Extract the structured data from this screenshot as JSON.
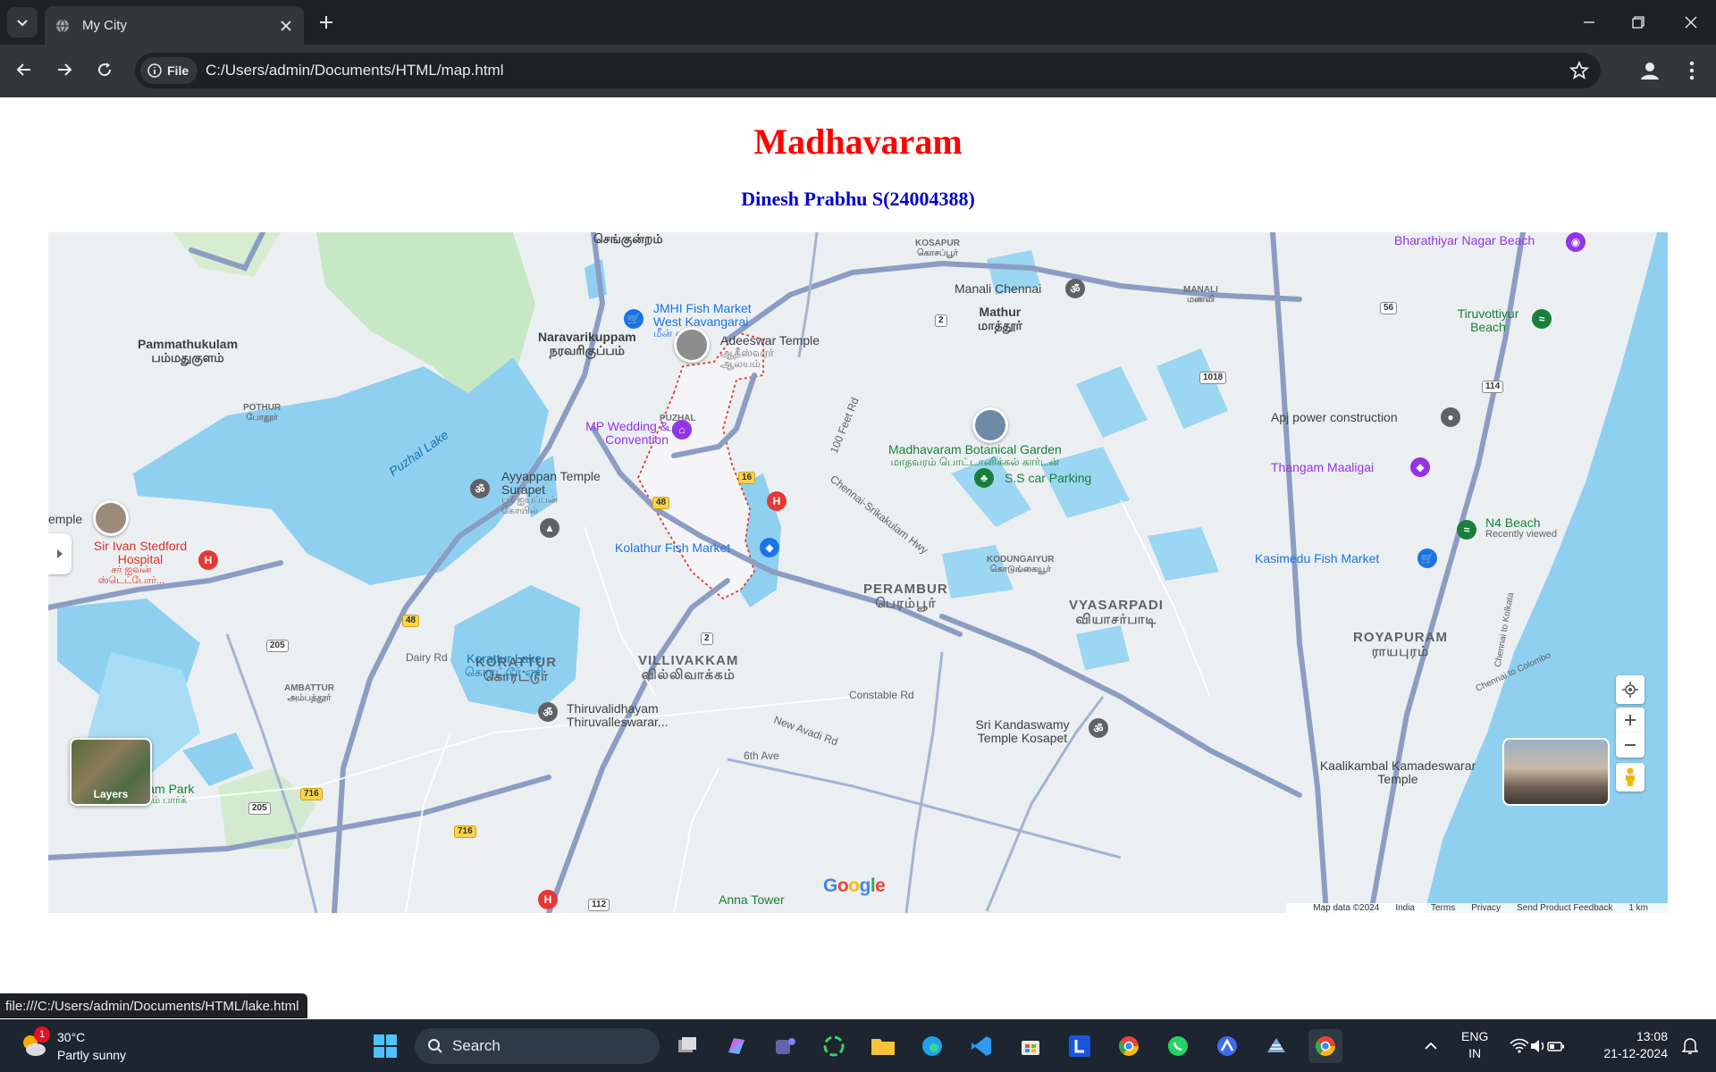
{
  "browser": {
    "tab_title": "My City",
    "url_chip": "File",
    "url": "C:/Users/admin/Documents/HTML/map.html",
    "status_url": "file:///C:/Users/admin/Documents/HTML/lake.html"
  },
  "page": {
    "title": "Madhavaram",
    "subtitle": "Dinesh Prabhu S(24004388)"
  },
  "map": {
    "places": [
      {
        "name": "Pammathukulam",
        "tamil": "பம்மதுகுளம்"
      },
      {
        "name": "Naravarikuppam",
        "tamil": "நரவரிகுப்பம்"
      },
      {
        "name": "Mathur",
        "tamil": "மாத்தூர்"
      },
      {
        "name": "PERAMBUR",
        "tamil": "பெரம்பூர்"
      },
      {
        "name": "VYASARPADI",
        "tamil": "வியாசர்பாடி"
      },
      {
        "name": "ROYAPURAM",
        "tamil": "ராயபுரம்"
      },
      {
        "name": "KORATTUR",
        "tamil": "கொரட்டூர்"
      },
      {
        "name": "VILLIVAKKAM",
        "tamil": "வில்லிவாக்கம்"
      },
      {
        "name": "Ayappakkam Park",
        "tamil": "அயப்பாக்கம் பார்க்"
      },
      {
        "name": "செங்குன்றம்",
        "tamil": ""
      }
    ],
    "small_places": [
      {
        "name": "POTHUR",
        "tamil": "போதூர்"
      },
      {
        "name": "PUZHAL",
        "tamil": "புழல்"
      },
      {
        "name": "KOSAPUR",
        "tamil": "கொசப்பூர்"
      },
      {
        "name": "MANALI",
        "tamil": "மணலி"
      },
      {
        "name": "KODUNGAIYUR",
        "tamil": "கொடுங்கையூர்"
      },
      {
        "name": "AMBATTUR",
        "tamil": "அம்பத்தூர்"
      }
    ],
    "water": [
      {
        "name": "Puzhal Lake"
      },
      {
        "name": "Korattur Lake",
        "tamil": "கொரட்டூர் ஏரி"
      }
    ],
    "pois": [
      {
        "name": "JMHI Fish Market West Kavangarai",
        "tamil": "மீன் சந்தை"
      },
      {
        "name": "Adeeswar Temple",
        "tamil": "ஆதீஸ்வரர் ஆலயம்"
      },
      {
        "name": "MP Wedding & Convention"
      },
      {
        "name": "Madhavaram Botanical Garden",
        "tamil": "மாதவரம் பொட்டானிக்கல் கார்டன்"
      },
      {
        "name": "S.S car Parking"
      },
      {
        "name": "Ayyappan Temple Surapet",
        "tamil": "ஸ்ரீ ஐயப்பன் கோயில்"
      },
      {
        "name": "Kolathur Fish Market"
      },
      {
        "name": "Sir Ivan Stedford Hospital",
        "tamil": "சர் ஐவன் ஸ்டெட்போர்..."
      },
      {
        "name": "Manali Chennai"
      },
      {
        "name": "Bharathiyar Nagar Beach"
      },
      {
        "name": "Tiruvottiyur Beach"
      },
      {
        "name": "Apj power construction"
      },
      {
        "name": "Thangam Maaligai"
      },
      {
        "name": "N4 Beach",
        "note": "Recently viewed"
      },
      {
        "name": "Kasimedu Fish Market"
      },
      {
        "name": "Thiruvalidhayam Thiruvalleswarar..."
      },
      {
        "name": "Sri Kandaswamy Temple Kosapet"
      },
      {
        "name": "Kaalikambal Kamadeswarar Temple"
      },
      {
        "name": "Anna Tower"
      },
      {
        "name": "emple"
      }
    ],
    "roads": [
      "100 Feet Rd",
      "Chennai-Srikakulam Hwy",
      "Dairy Rd",
      "Constable Rd",
      "New Avadi Rd",
      "6th Ave",
      "Chennai to Kolkata",
      "Chennai to Colombo"
    ],
    "shields": [
      "2",
      "16",
      "48",
      "48",
      "205",
      "205",
      "716",
      "716",
      "56",
      "114",
      "1018",
      "112",
      "2"
    ],
    "layers_label": "Layers",
    "google_logo": "Google",
    "attribution": [
      "Map data ©2024",
      "India",
      "Terms",
      "Privacy",
      "Send Product Feedback",
      "1 km"
    ]
  },
  "taskbar": {
    "weather_temp": "30°C",
    "weather_desc": "Partly sunny",
    "weather_badge": "1",
    "search_placeholder": "Search",
    "lang_1": "ENG",
    "lang_2": "IN",
    "time": "13:08",
    "date": "21-12-2024"
  },
  "colors": {
    "title": "#ff0000",
    "subtitle": "#0000cc",
    "water": "#8fd0f0",
    "park": "#c7e8c5",
    "highway": "#8b9dc3",
    "boundary": "#e53935"
  }
}
